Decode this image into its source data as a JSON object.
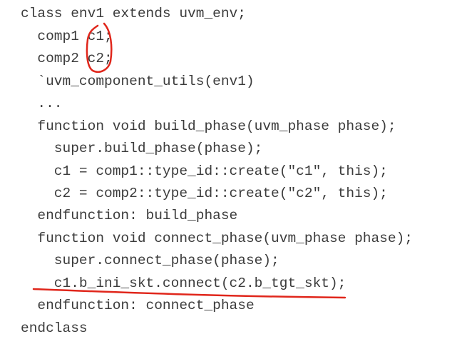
{
  "code_lines": [
    "class env1 extends uvm_env;",
    "  comp1 c1;",
    "  comp2 c2;",
    "  `uvm_component_utils(env1)",
    "  ...",
    "  function void build_phase(uvm_phase phase);",
    "    super.build_phase(phase);",
    "    c1 = comp1::type_id::create(\"c1\", this);",
    "    c2 = comp2::type_id::create(\"c2\", this);",
    "  endfunction: build_phase",
    "  function void connect_phase(uvm_phase phase);",
    "    super.connect_phase(phase);",
    "    c1.b_ini_skt.connect(c2.b_tgt_skt);",
    "  endfunction: connect_phase",
    "endclass"
  ],
  "annotation_color": "#e0261b",
  "text_color": "#3b3b3b"
}
